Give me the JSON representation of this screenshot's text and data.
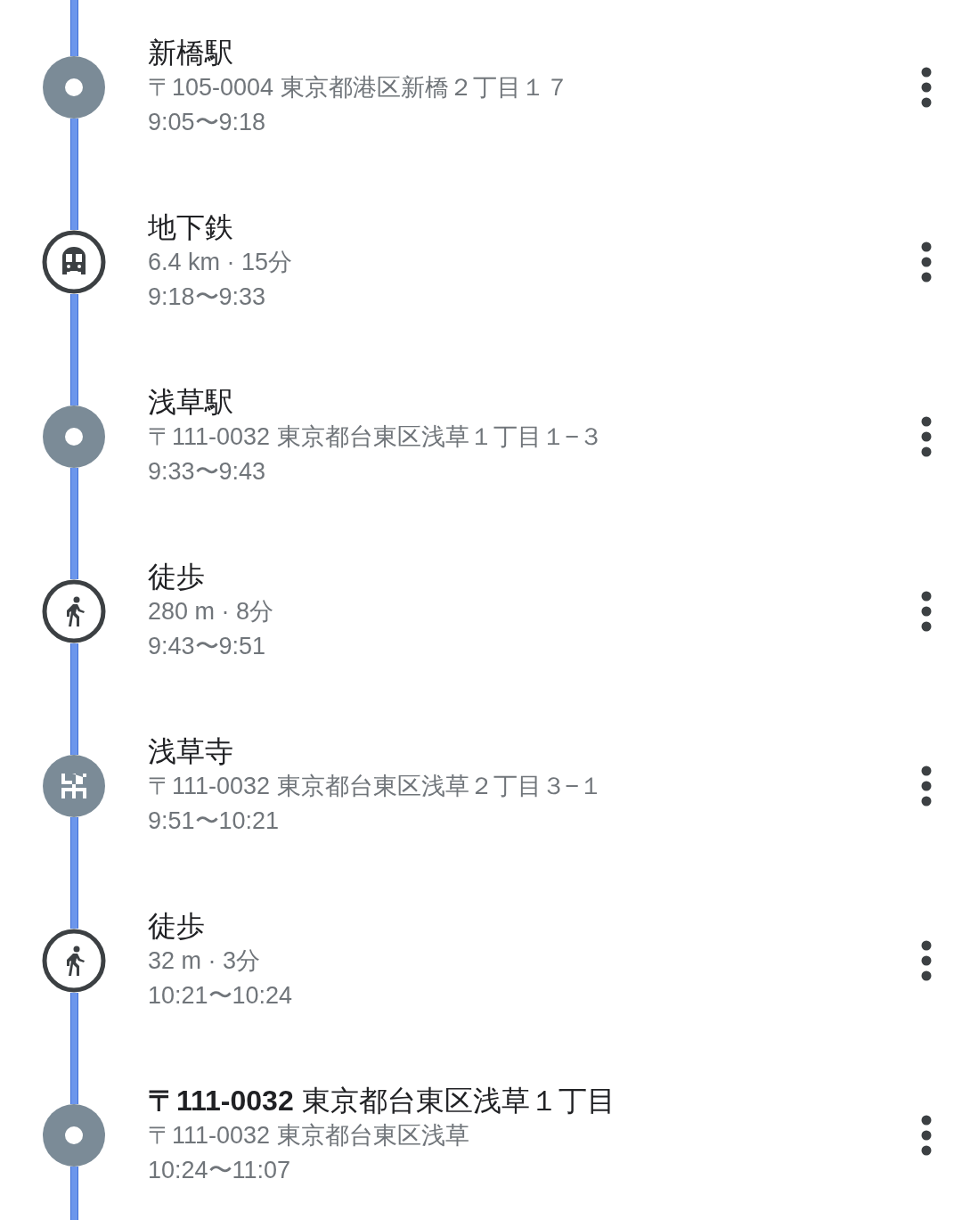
{
  "timeline": [
    {
      "kind": "stop",
      "title": "新橋駅",
      "detail": "〒105-0004 東京都港区新橋２丁目１７",
      "time": "9:05〜9:18"
    },
    {
      "kind": "transit",
      "title": "地下鉄",
      "detail": "6.4 km · 15分",
      "time": "9:18〜9:33"
    },
    {
      "kind": "stop",
      "title": "浅草駅",
      "detail": "〒111-0032 東京都台東区浅草１丁目１−３",
      "time": "9:33〜9:43"
    },
    {
      "kind": "walk",
      "title": "徒歩",
      "detail": "280 m · 8分",
      "time": "9:43〜9:51"
    },
    {
      "kind": "temple",
      "title": "浅草寺",
      "detail": "〒111-0032 東京都台東区浅草２丁目３−１",
      "time": "9:51〜10:21"
    },
    {
      "kind": "walk",
      "title": "徒歩",
      "detail": "32 m · 3分",
      "time": "10:21〜10:24"
    },
    {
      "kind": "stop",
      "title": "**〒111-0032** 東京都台東区浅草１丁目",
      "detail": "〒111-0032 東京都台東区浅草",
      "time": "10:24〜11:07"
    }
  ]
}
